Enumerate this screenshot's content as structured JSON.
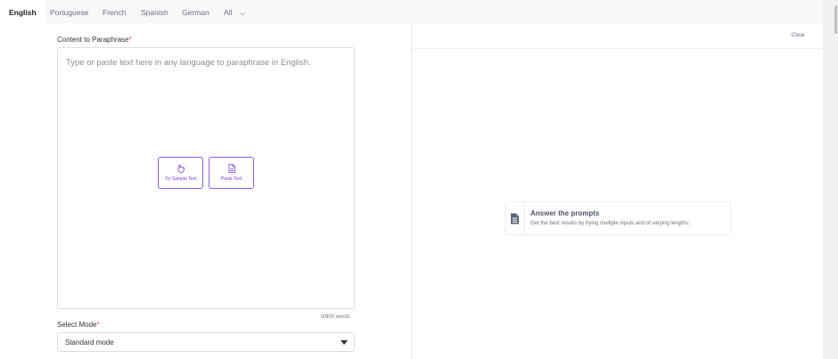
{
  "tabs": [
    {
      "label": "English",
      "active": true
    },
    {
      "label": "Portuguese"
    },
    {
      "label": "French"
    },
    {
      "label": "Spanish"
    },
    {
      "label": "German"
    },
    {
      "label": "All"
    }
  ],
  "input": {
    "label": "Content to Paraphrase",
    "required_mark": "*",
    "placeholder": "Type or paste text here in any language to paraphrase in English.",
    "sample_button": "Try Sample Text",
    "paste_button": "Paste Text",
    "word_count": "0/900 words"
  },
  "mode": {
    "label": "Select Mode",
    "required_mark": "*",
    "selected": "Standard mode"
  },
  "output": {
    "clear_label": "Clear",
    "prompt_title": "Answer the prompts",
    "prompt_subtitle": "Get the best results by trying multiple inputs and of varying lengths."
  },
  "colors": {
    "accent": "#8b5cf6",
    "required": "#d84a4a"
  },
  "icons": {
    "sample": "hand-pointer-icon",
    "paste": "document-icon",
    "prompt": "document-lines-icon",
    "dropdown": "caret-down-icon"
  }
}
